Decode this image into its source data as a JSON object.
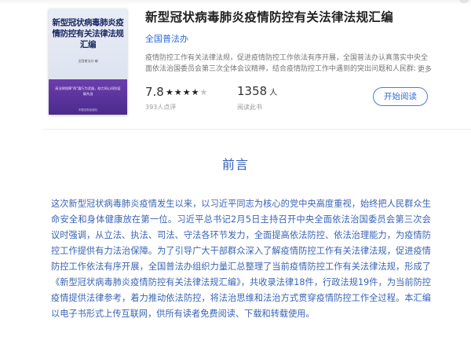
{
  "book": {
    "title": "新型冠状病毒肺炎疫情防控有关法律法规汇编",
    "author": "全国普法办",
    "description": "疫情防控工作有关法律法规，促进疫情防控工作依法有序开展，全国普法办认真落实中央全面依法治国委员会第三次全体会议精神，结合疫情防控工作中遇到的突出问题和人民群众普遍",
    "more_label": "更多",
    "rating": "7.8",
    "stars": {
      "full": 3,
      "half": 1,
      "empty": 1
    },
    "rating_count": "393人点评",
    "reader_count": "1358",
    "reader_unit": "人",
    "reader_label": "阅读此书",
    "read_button_label": "开始阅读"
  },
  "cover": {
    "title": "新型冠状病毒肺炎疫情防控有关法律法规汇编",
    "publisher_line": "全国普法办  编",
    "band_text": "高法律保障\"两\"篇行为武器，助力同心同防疫情共战",
    "band_footer": "中国法制出版社",
    "colors": {
      "band": "#5a33a0",
      "title": "#1d2a64"
    }
  },
  "section": {
    "title": "前言"
  },
  "preface": {
    "text": "这次新型冠状病毒肺炎疫情发生以来，以习近平同志为核心的党中央高度重视，始终把人民群众生命安全和身体健康放在第一位。习近平总书记2月5日主持召开中央全面依法治国委员会第三次会议时强调，从立法、执法、司法、守法各环节发力，全面提高依法防控、依法治理能力，为疫情防控工作提供有力法治保障。为了引导广大干部群众深入了解疫情防控工作有关法律法规，促进疫情防控工作依法有序开展，全国普法办组织力量汇总整理了当前疫情防控工作有关法律法规，形成了《新型冠状病毒肺炎疫情防控有关法律法规汇编》，共收录法律18件，行政法规19件，为当前防控疫情提供法律参考，着力推动依法防控，将法治思维和法治方式贯穿疫情防控工作全过程。本汇编以电子书形式上传互联网，供所有读者免费阅读、下载和转载使用。"
  },
  "colors": {
    "accent": "#2f6bd8",
    "preface_text": "#3a63b5",
    "muted": "#999999"
  }
}
